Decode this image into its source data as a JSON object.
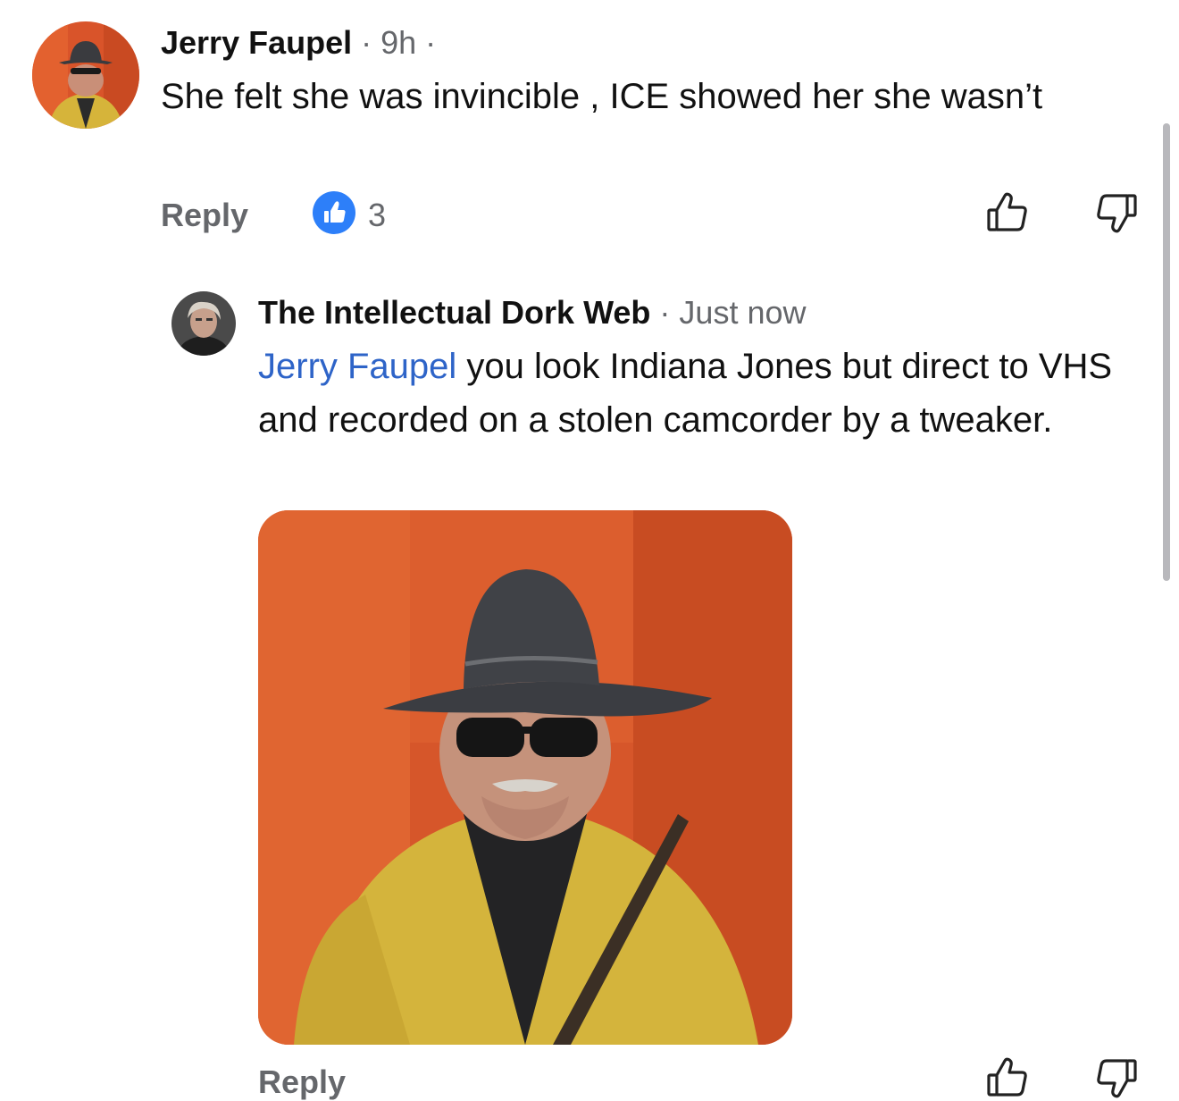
{
  "comment": {
    "author": "Jerry Faupel",
    "time": "9h",
    "text": "She felt she was invincible , ICE showed her she wasn’t",
    "reply_label": "Reply",
    "reaction_count": "3",
    "reaction_icon": "like-icon"
  },
  "reply": {
    "author": "The Intellectual Dork Web",
    "time": "Just now",
    "mention": "Jerry Faupel",
    "text": " you look Indiana Jones but direct to VHS and recorded on a stolen camcorder by a tweaker.",
    "reply_label": "Reply"
  },
  "colors": {
    "accent": "#2d7ff9",
    "mention": "#2e64c8",
    "meta": "#65676b"
  }
}
